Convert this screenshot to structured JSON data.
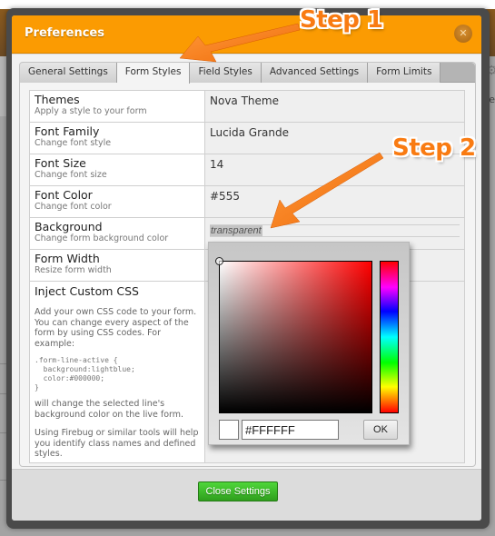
{
  "background_app": {
    "right_partial_text": "re"
  },
  "dialog": {
    "title": "Preferences",
    "close_icon": "close-x-icon",
    "tabs": [
      {
        "label": "General Settings",
        "active": false
      },
      {
        "label": "Form Styles",
        "active": true
      },
      {
        "label": "Field Styles",
        "active": false
      },
      {
        "label": "Advanced Settings",
        "active": false
      },
      {
        "label": "Form Limits",
        "active": false
      }
    ],
    "settings": [
      {
        "label": "Themes",
        "description": "Apply a style to your form",
        "value": "Nova Theme"
      },
      {
        "label": "Font Family",
        "description": "Change font style",
        "value": "Lucida Grande"
      },
      {
        "label": "Font Size",
        "description": "Change font size",
        "value": "14"
      },
      {
        "label": "Font Color",
        "description": "Change font color",
        "value": "#555"
      },
      {
        "label": "Background",
        "description": "Change form background color",
        "value": "transparent"
      },
      {
        "label": "Form Width",
        "description": "Resize form width",
        "value": ""
      }
    ],
    "custom_css": {
      "label": "Inject Custom CSS",
      "description_1": "Add your own CSS code to your form. You can change every aspect of the form by using CSS codes. For example:",
      "code_example": ".form-line-active {\n  background:lightblue;\n  color:#000000;\n}",
      "description_2": "will change the selected line's background color on the live form.",
      "description_3": "Using Firebug or similar tools will help you identify class names and defined styles."
    },
    "color_picker": {
      "hex_value": "#FFFFFF",
      "ok_label": "OK",
      "selected_color": "#FFFFFF",
      "hue": "red"
    },
    "footer": {
      "close_button_label": "Close Settings"
    }
  },
  "annotations": {
    "step1": "Step 1",
    "step2": "Step 2",
    "color": "#F97B12"
  }
}
